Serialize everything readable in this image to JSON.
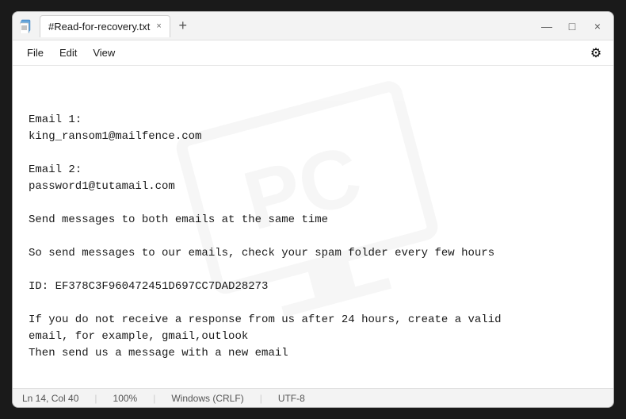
{
  "window": {
    "title": "#Read-for-recovery.txt",
    "icon": "📄"
  },
  "titlebar": {
    "tab_label": "#Read-for-recovery.txt",
    "close_tab": "×",
    "new_tab": "+",
    "minimize": "—",
    "maximize": "□",
    "close": "×"
  },
  "menu": {
    "items": [
      "File",
      "Edit",
      "View"
    ],
    "settings_icon": "⚙"
  },
  "editor": {
    "content": "Email 1:\nking_ransom1@mailfence.com\n\nEmail 2:\npassword1@tutamail.com\n\nSend messages to both emails at the same time\n\nSo send messages to our emails, check your spam folder every few hours\n\nID: EF378C3F960472451D697CC7DAD28273\n\nIf you do not receive a response from us after 24 hours, create a valid\nemail, for example, gmail,outlook\nThen send us a message with a new email"
  },
  "statusbar": {
    "line_col": "Ln 14, Col 40",
    "zoom": "100%",
    "line_ending": "Windows (CRLF)",
    "encoding": "UTF-8"
  }
}
